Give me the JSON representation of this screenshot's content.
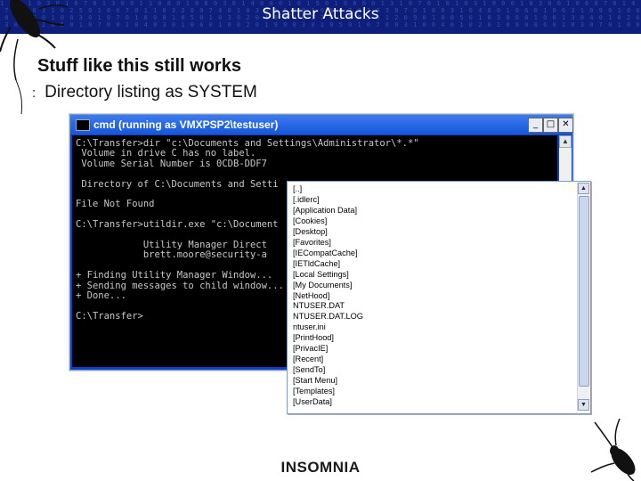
{
  "header": {
    "title": "Shatter Attacks",
    "hex_pattern": "1 0 0 1 0 3 0 1 0 7 0 1 3 0 0 1 3 0 8 0 1 0 6 0 3 0 1 4 0 0 0 1 0 1 5 0 1 0 8 0 0 1 3 1 0 7 0 1 0 1 0 3 1 9 0 0 1 0 3 0 0 1 0 6 0 7 0 1 4 0 0 1 0 5 0 1 0 0 1 8\n 7 0 4 0 3 1 0 2 5 0 1 0 0 7 0 1 1 0 3 2 0 0 7 4 0 1 0 3 0 1 6 0 0 1 0 5 0 2 0 1 0 3 0 7 0 1 0 0 3 1 0 4 8 0 1 0 6 0 1 0 0 3 1 0 9 0 1 0 0 2 0 1 0 7 0 3 0 1 0 4 0\n 0 1 0 6 0 1 0 0 3 0 1 0 7 0 1 8 0 0 1 0 5 0 1 0 3 0 2 0 1 0 0 4 0 1 7 0 1 0 0 3 0 1 2 0 9 0 1 0 0 5 0 1 0 3 0 6 0 1 0 0 1 3 0 4 0 1 0 2 0 0 7 0 1 0 8 0 0 1 3 0\n 3 0 1 0 2 0 5 0 1 0 7 0 0 1 0 4 0 3 0 1 0 6 0 1 0 0 2 0 1 9 0 0 3 0 1 0 5 0 1 0 7 0 0 3 1 0 0 4 0 1 0 2 0 1 0 8 0 0 6 0 1 0 3 0 7 0 1 0 0 5 0 1 4 0 0 1 0 2 0"
  },
  "slide": {
    "heading": "Stuff like this still works",
    "bullet_mark": ":",
    "bullet_text": "Directory listing as SYSTEM"
  },
  "cmd_window": {
    "title": "cmd (running as VMXPSP2\\testuser)",
    "min_glyph": "_",
    "max_glyph": "□",
    "close_glyph": "✕",
    "scroll_up_glyph": "▲",
    "scroll_down_glyph": "▼",
    "output": "C:\\Transfer>dir \"c:\\Documents and Settings\\Administrator\\*.*\"\n Volume in drive C has no label.\n Volume Serial Number is 0CDB-DDF7\n\n Directory of C:\\Documents and Setti\n\nFile Not Found\n\nC:\\Transfer>utildir.exe \"c:\\Document\n\n            Utility Manager Direct\n            brett.moore@security-a\n\n+ Finding Utility Manager Window...\n+ Sending messages to child window...\n+ Done...\n\nC:\\Transfer>"
  },
  "listbox": {
    "items": [
      "[..]",
      "[.idlerc]",
      "[Application Data]",
      "[Cookies]",
      "[Desktop]",
      "[Favorites]",
      "[IECompatCache]",
      "[IETldCache]",
      "[Local Settings]",
      "[My Documents]",
      "[NetHood]",
      "NTUSER.DAT",
      "NTUSER.DAT.LOG",
      "ntuser.ini",
      "[PrintHood]",
      "[PrivacIE]",
      "[Recent]",
      "[SendTo]",
      "[Start Menu]",
      "[Templates]",
      "[UserData]"
    ],
    "scroll_up_glyph": "▲",
    "scroll_down_glyph": "▼"
  },
  "footer": {
    "logo_text": "INSOMNIA"
  },
  "colors": {
    "header_bg": "#0d1f7a",
    "titlebar_blue": "#1556d8",
    "console_bg": "#000000",
    "console_text": "#c8c8c8"
  }
}
